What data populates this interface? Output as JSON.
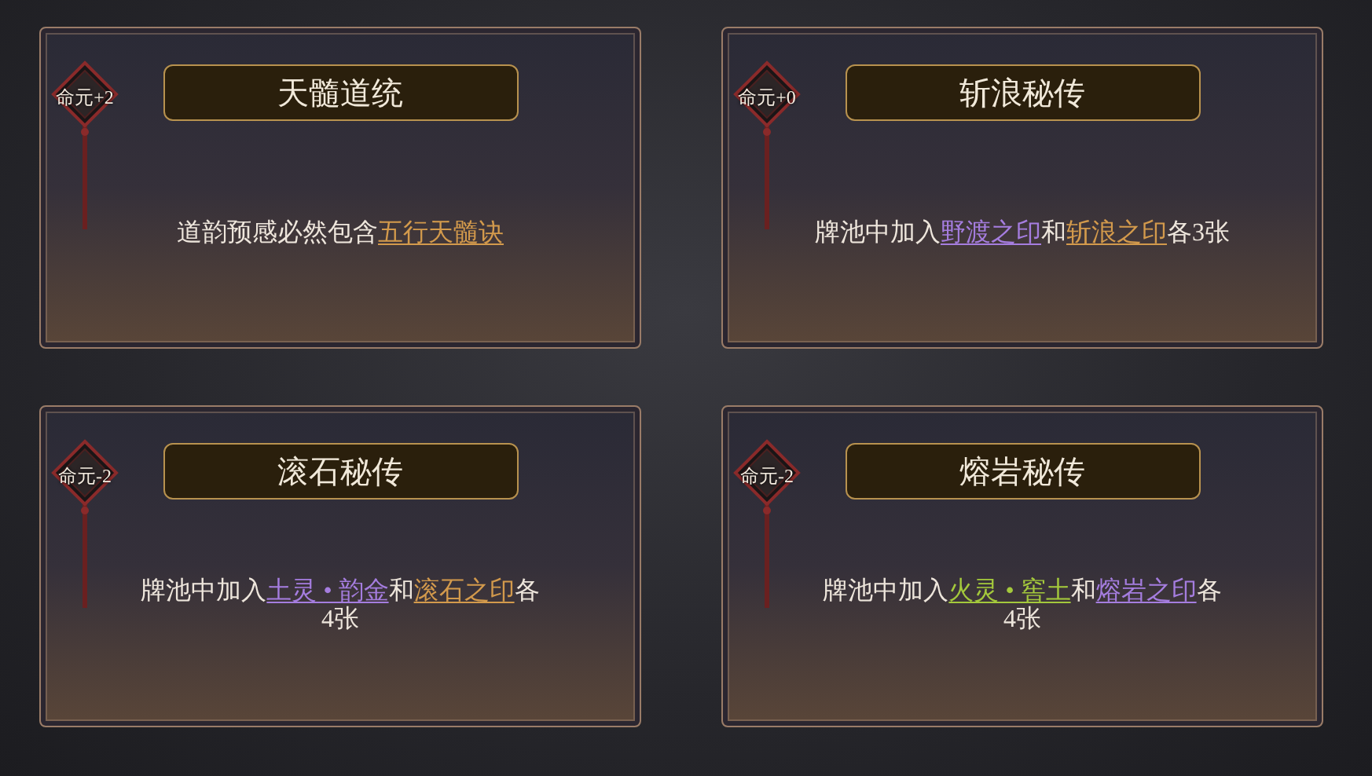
{
  "cards": [
    {
      "badge": "命元+2",
      "title": "天髓道统",
      "description": [
        [
          {
            "kind": "plain",
            "text": "道韵预感必然包含"
          },
          {
            "kind": "link",
            "text": "五行天髓诀",
            "color": "#d39a4c"
          }
        ]
      ]
    },
    {
      "badge": "命元+0",
      "title": "斩浪秘传",
      "description": [
        [
          {
            "kind": "plain",
            "text": "牌池中加入"
          },
          {
            "kind": "link",
            "text": "野渡之印",
            "color": "#a57ddf"
          },
          {
            "kind": "plain",
            "text": "和"
          },
          {
            "kind": "link",
            "text": "斩浪之印",
            "color": "#d39a4c"
          },
          {
            "kind": "plain",
            "text": "各3张"
          }
        ]
      ]
    },
    {
      "badge": "命元-2",
      "title": "滚石秘传",
      "description": [
        [
          {
            "kind": "plain",
            "text": "牌池中加入"
          },
          {
            "kind": "link",
            "text": "土灵 • 韵金",
            "color": "#a57ddf"
          },
          {
            "kind": "plain",
            "text": "和"
          },
          {
            "kind": "link",
            "text": "滚石之印",
            "color": "#d39a4c"
          },
          {
            "kind": "plain",
            "text": "各"
          }
        ],
        [
          {
            "kind": "plain",
            "text": "4张"
          }
        ]
      ]
    },
    {
      "badge": "命元-2",
      "title": "熔岩秘传",
      "description": [
        [
          {
            "kind": "plain",
            "text": "牌池中加入"
          },
          {
            "kind": "link",
            "text": "火灵 • 窖土",
            "color": "#a4c93c"
          },
          {
            "kind": "plain",
            "text": "和"
          },
          {
            "kind": "link",
            "text": "熔岩之印",
            "color": "#a57ddf"
          },
          {
            "kind": "plain",
            "text": "各"
          }
        ],
        [
          {
            "kind": "plain",
            "text": "4张"
          }
        ]
      ]
    }
  ]
}
